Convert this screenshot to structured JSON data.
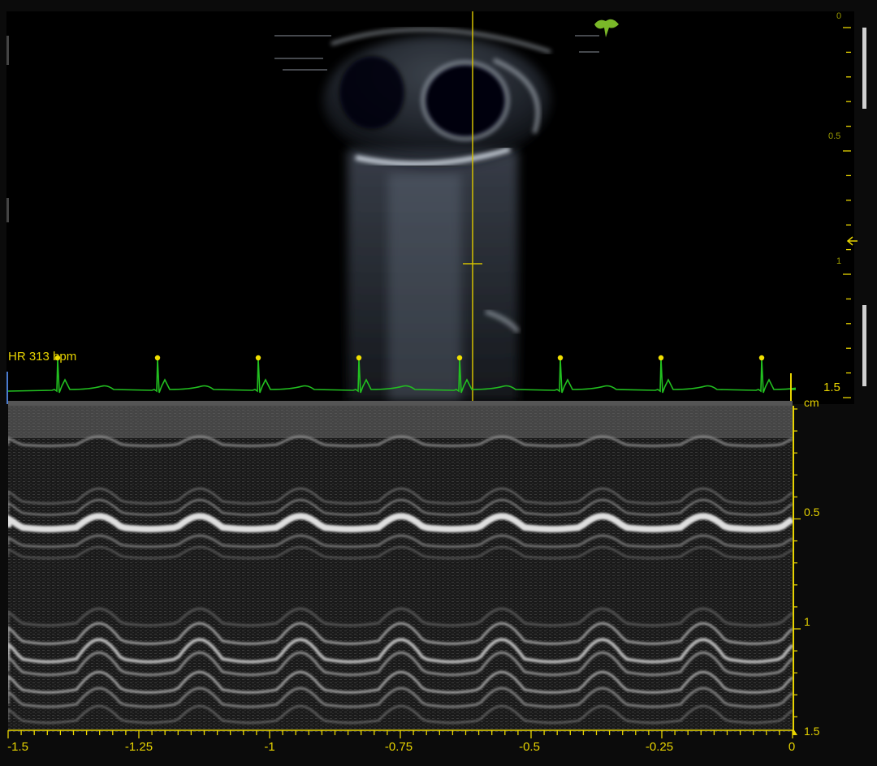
{
  "ecg": {
    "heart_rate_label": "HR 313 bpm"
  },
  "m_mode": {
    "depth_unit": "cm",
    "depth_ticks": [
      "0.5",
      "1",
      "1.5"
    ],
    "time_ticks": [
      "-1.5",
      "-1.25",
      "-1",
      "-0.75",
      "-0.5",
      "-0.25",
      "0"
    ]
  },
  "b_mode": {
    "depth_ticks": [
      "0",
      "0.5",
      "1",
      "1.5"
    ]
  },
  "icons": {
    "logo": "ginkgo-leaf-icon",
    "marker": "chevron-up-icon"
  },
  "colors": {
    "accent": "#e8d400",
    "ecg_trace": "#22c020",
    "logo": "#7ab828"
  }
}
